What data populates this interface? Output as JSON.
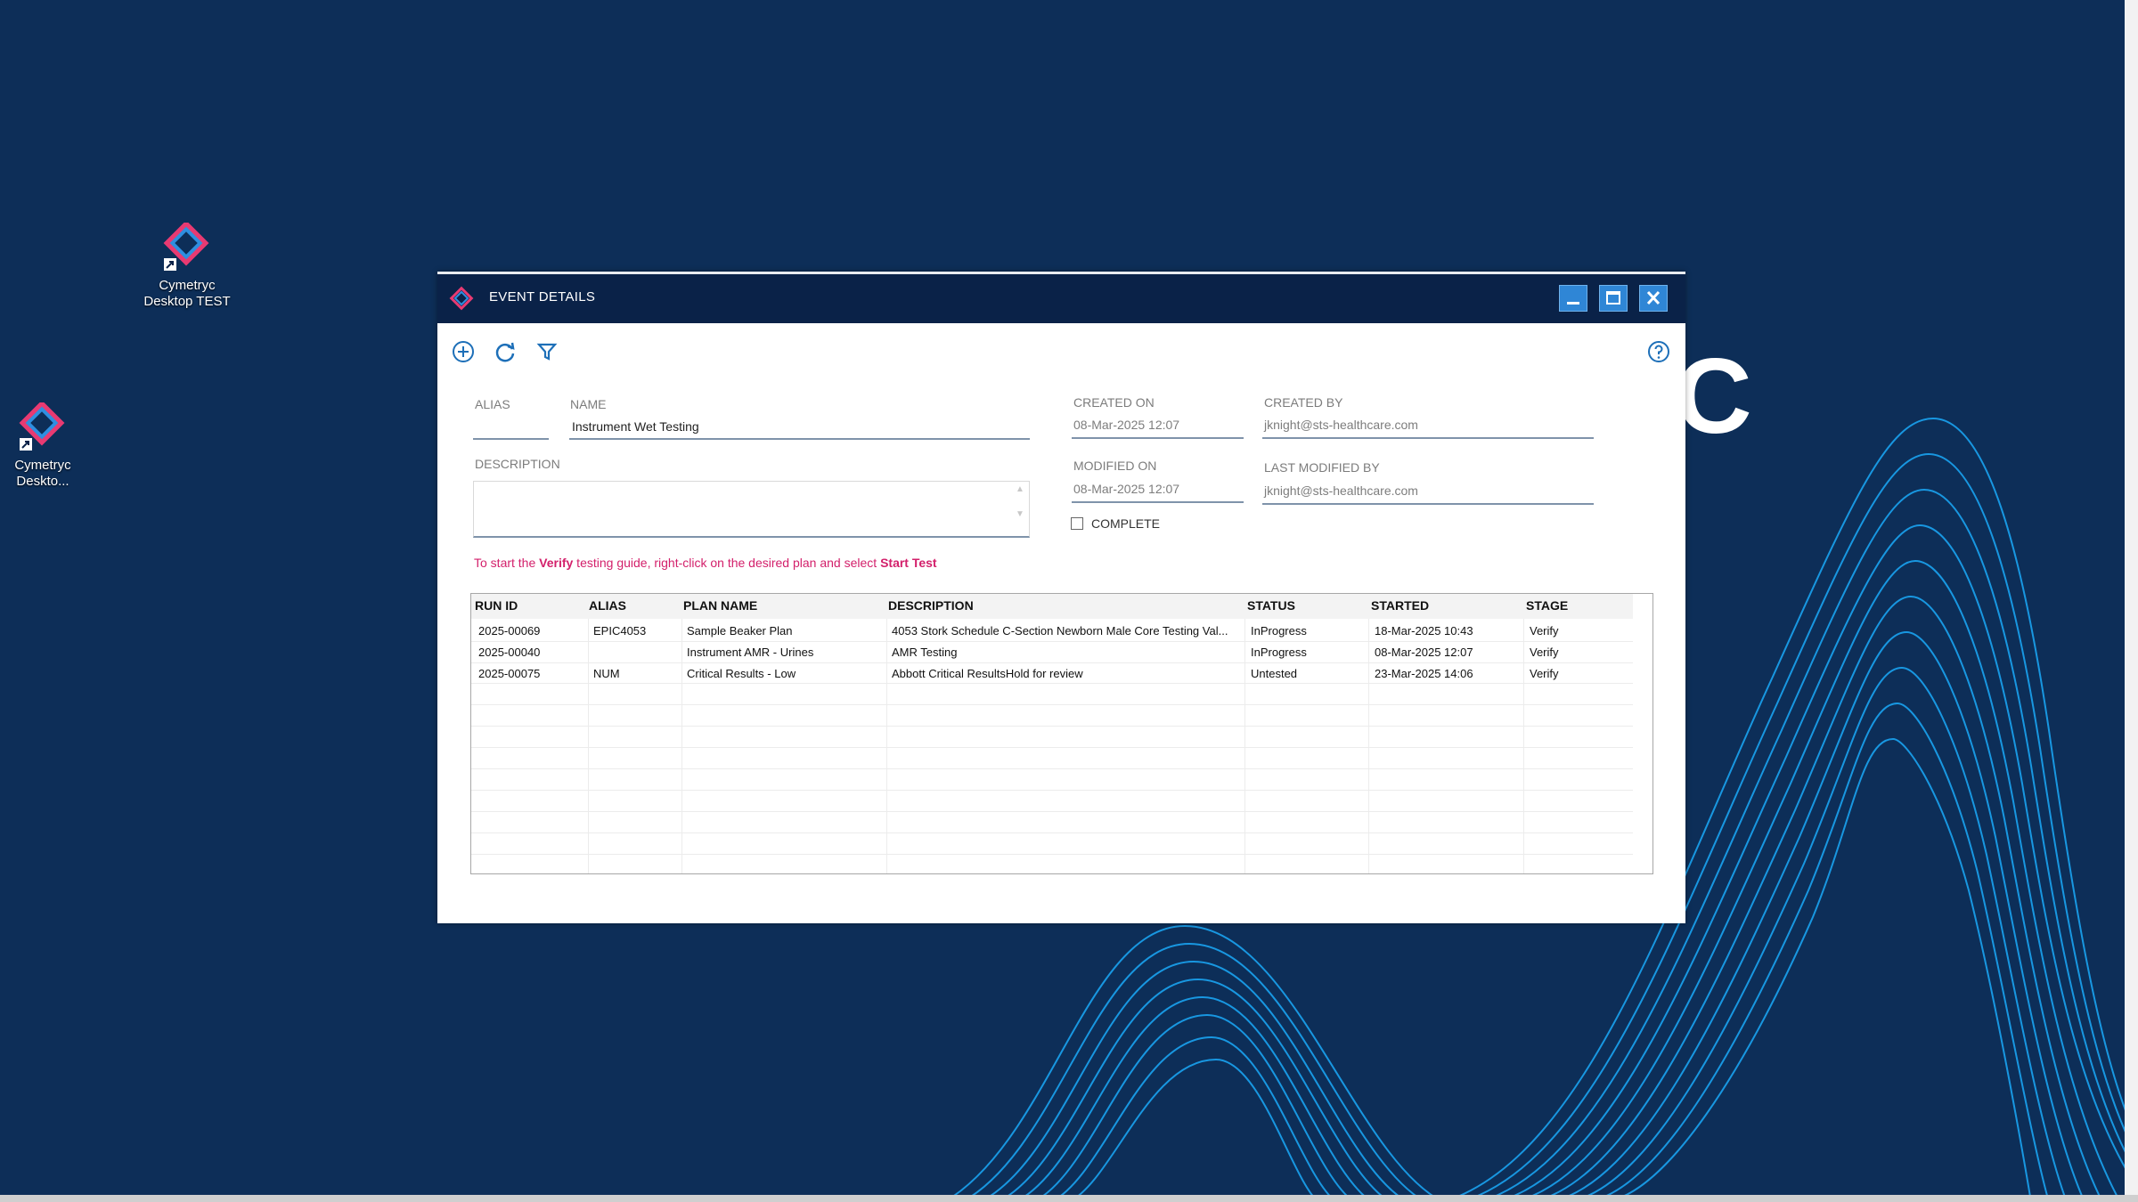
{
  "desktop": {
    "icons": [
      {
        "label_line1": "Cymetryc",
        "label_line2": "Desktop TEST"
      },
      {
        "label_line1": "Cymetryc",
        "label_line2": "Deskto..."
      }
    ],
    "background_colors": {
      "base": "#0d2e58",
      "wave": "#1aa3f0"
    }
  },
  "window": {
    "title": "EVENT DETAILS",
    "controls": {
      "minimize": "minimize-icon",
      "maximize": "maximize-icon",
      "close": "close-icon"
    },
    "toolbar": {
      "add_icon": "plus-circle-icon",
      "refresh_icon": "refresh-icon",
      "filter_icon": "filter-icon",
      "help_icon": "help-icon"
    }
  },
  "form": {
    "alias_label": "ALIAS",
    "alias_value": "",
    "name_label": "NAME",
    "name_value": "Instrument Wet Testing",
    "created_on_label": "CREATED ON",
    "created_on_value": "08-Mar-2025 12:07",
    "created_by_label": "CREATED BY",
    "created_by_value": "jknight@sts-healthcare.com",
    "description_label": "DESCRIPTION",
    "description_value": "",
    "modified_on_label": "MODIFIED ON",
    "modified_on_value": "08-Mar-2025 12:07",
    "last_modified_by_label": "LAST MODIFIED BY",
    "last_modified_by_value": "jknight@sts-healthcare.com",
    "complete_label": "COMPLETE",
    "complete_checked": false
  },
  "hint": {
    "part1": "To start the ",
    "bold1": "Verify",
    "part2": " testing guide, right-click on the desired plan and select ",
    "bold2": "Start Test"
  },
  "table": {
    "columns": [
      "RUN ID",
      "ALIAS",
      "PLAN NAME",
      "DESCRIPTION",
      "STATUS",
      "STARTED",
      "STAGE"
    ],
    "rows": [
      {
        "run_id": "2025-00069",
        "alias": "EPIC4053",
        "plan_name": "Sample Beaker Plan",
        "description": "4053 Stork Schedule C-Section Newborn Male Core Testing Val...",
        "status": "InProgress",
        "started": "18-Mar-2025 10:43",
        "stage": "Verify"
      },
      {
        "run_id": "2025-00040",
        "alias": "",
        "plan_name": "Instrument AMR - Urines",
        "description": "AMR Testing",
        "status": "InProgress",
        "started": "08-Mar-2025 12:07",
        "stage": "Verify"
      },
      {
        "run_id": "2025-00075",
        "alias": "NUM",
        "plan_name": "Critical Results - Low",
        "description": "Abbott Critical ResultsHold for review",
        "status": "Untested",
        "started": "23-Mar-2025 14:06",
        "stage": "Verify"
      }
    ]
  }
}
